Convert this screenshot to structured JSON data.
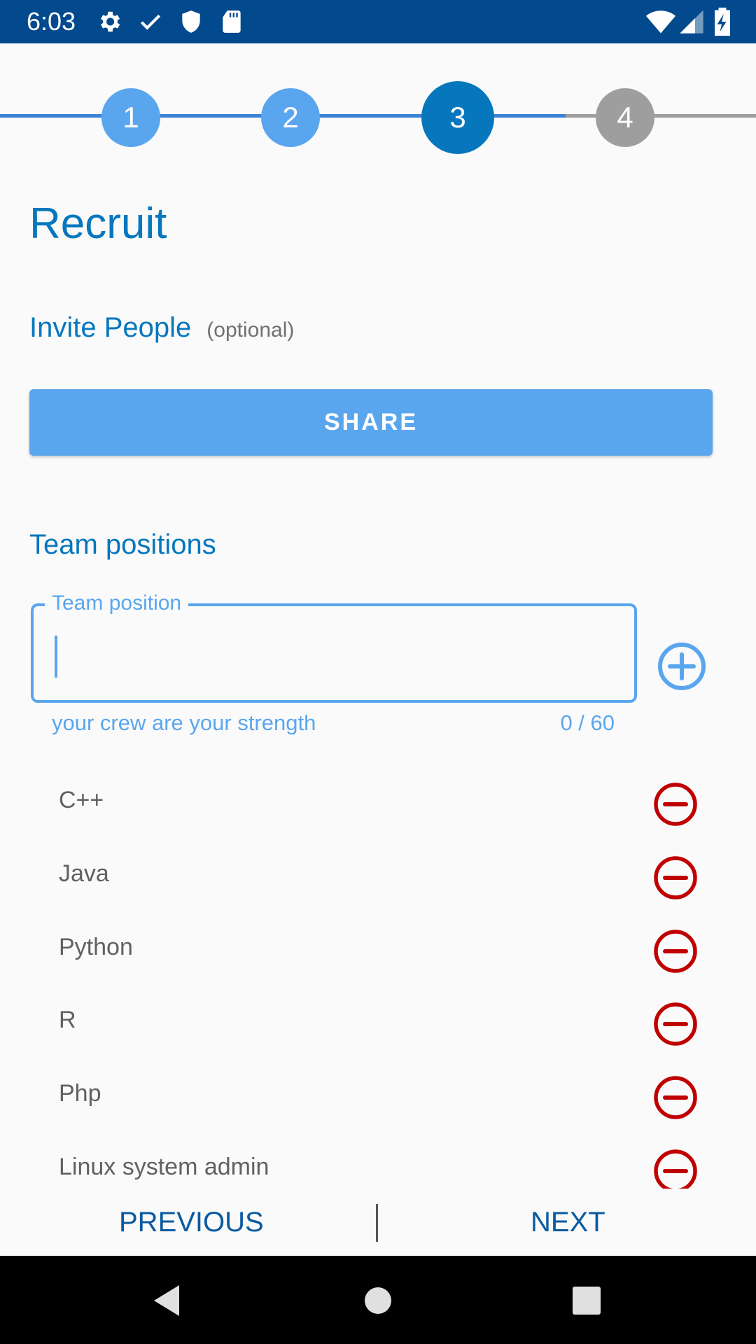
{
  "status_bar": {
    "time": "6:03",
    "left_icons": [
      "gear-icon",
      "check-icon",
      "shield-icon",
      "sd-card-icon"
    ],
    "right_icons": [
      "wifi-icon",
      "signal-icon",
      "battery-charging-icon"
    ],
    "color": "#02498d"
  },
  "stepper": {
    "steps": [
      {
        "label": "1",
        "state": "completed"
      },
      {
        "label": "2",
        "state": "completed"
      },
      {
        "label": "3",
        "state": "active"
      },
      {
        "label": "4",
        "state": "pending"
      }
    ],
    "colors": {
      "completed": "#5aa6ee",
      "active": "#0677bd",
      "pending": "#9e9e9e"
    }
  },
  "page": {
    "title": "Recruit",
    "invite_label": "Invite People",
    "invite_optional": "(optional)",
    "share_label": "SHARE",
    "team_heading": "Team positions"
  },
  "position_input": {
    "label": "Team position",
    "value": "",
    "helper": "your crew are your strength",
    "counter": "0 / 60"
  },
  "positions": [
    {
      "name": "C++"
    },
    {
      "name": "Java"
    },
    {
      "name": "Python"
    },
    {
      "name": "R"
    },
    {
      "name": "Php"
    },
    {
      "name": "Linux system admin"
    }
  ],
  "actions": {
    "previous": "PREVIOUS",
    "next": "NEXT"
  },
  "system_nav": [
    "back-icon",
    "home-icon",
    "recents-icon"
  ],
  "colors": {
    "accent": "#0677bd",
    "light_accent": "#5aa6ee",
    "remove": "#c00000"
  }
}
